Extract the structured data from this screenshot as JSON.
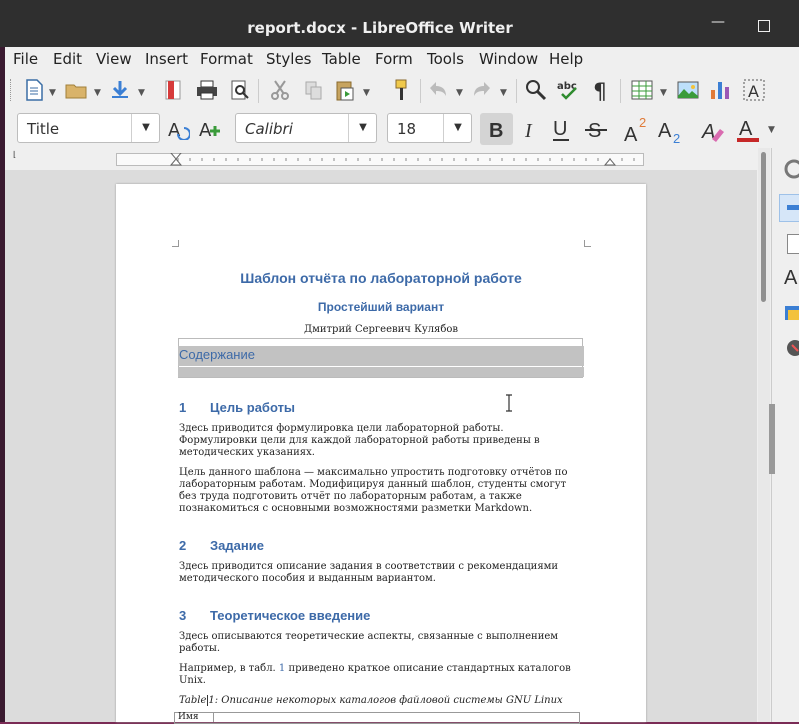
{
  "window": {
    "title": "report.docx - LibreOffice Writer"
  },
  "menu": [
    "File",
    "Edit",
    "View",
    "Insert",
    "Format",
    "Styles",
    "Table",
    "Form",
    "Tools",
    "Window",
    "Help"
  ],
  "formatting": {
    "para_style": "Title",
    "font_name": "Calibri",
    "font_size": "18"
  },
  "document": {
    "title": "Шаблон отчёта по лабораторной работе",
    "subtitle": "Простейший вариант",
    "author": "Дмитрий Сергеевич Кулябов",
    "toc_label": "Содержание",
    "sections": [
      {
        "num": "1",
        "heading": "Цель работы",
        "paras": [
          [
            "Здесь приводится формулировка цели лабораторной работы.",
            "Формулировки цели для каждой лабораторной работы приведены в",
            "методических указаниях."
          ],
          [
            "Цель данного шаблона — максимально упростить подготовку отчётов по",
            "лабораторным работам. Модифицируя данный шаблон, студенты смогут",
            "без труда подготовить отчёт по лабораторным работам, а также",
            "познакомиться с основными возможностями разметки Markdown."
          ]
        ]
      },
      {
        "num": "2",
        "heading": "Задание",
        "paras": [
          [
            "Здесь приводится описание задания в соответствии с рекомендациями",
            "методического пособия и выданным вариантом."
          ]
        ]
      },
      {
        "num": "3",
        "heading": "Теоретическое введение",
        "paras": [
          [
            "Здесь описываются теоретические аспекты, связанные с выполнением",
            "работы."
          ]
        ]
      }
    ],
    "table_ref": {
      "before": "Например, в табл.",
      "num": "1",
      "after": "приведено краткое описание стандартных каталогов",
      "line2": "Unix."
    },
    "caption": {
      "word": "Table",
      "rest": "1: Описание некоторых каталогов файловой системы GNU Linux"
    },
    "table_header_first": "Имя"
  }
}
